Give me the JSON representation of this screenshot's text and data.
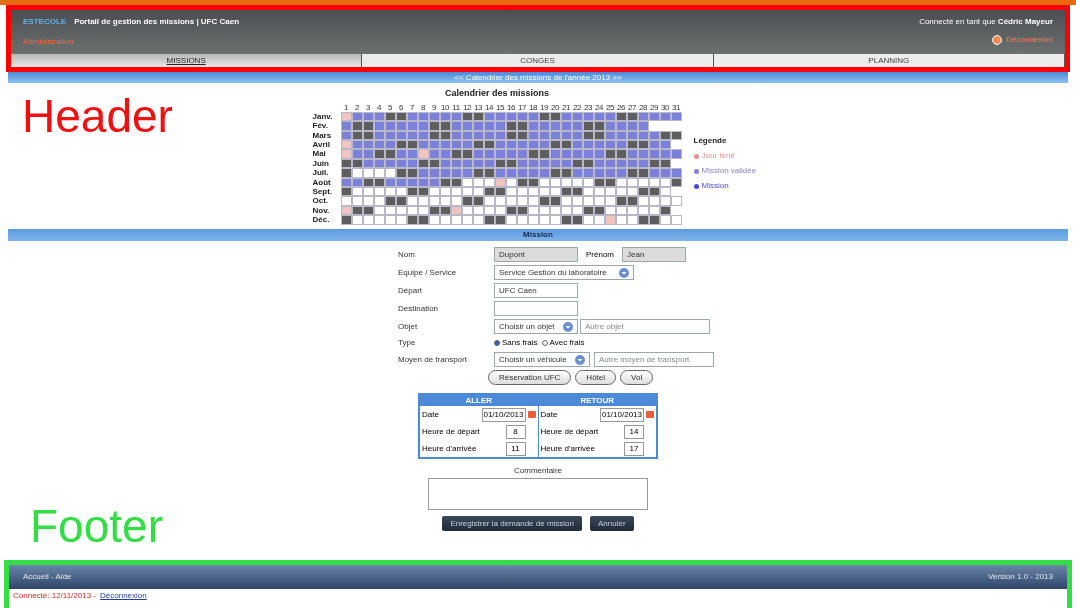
{
  "annotations": {
    "header_label": "Header",
    "footer_label": "Footer"
  },
  "header": {
    "brand": "ESTECOLE",
    "title": "Portail de gestion des missions | UFC Caen",
    "user_text": "Connecté en tant que **Cédric Mayeur**",
    "admin_link": "Administration",
    "logout": "Déconnexion"
  },
  "tabs": [
    {
      "label": "MISSIONS",
      "selected": true
    },
    {
      "label": "CONGES",
      "selected": false
    },
    {
      "label": "PLANNING",
      "selected": false
    }
  ],
  "subbar": "<< Calendrier des missions de l'année 2013 >>",
  "calendar": {
    "title": "Calendrier des missions",
    "days": [
      "1",
      "2",
      "3",
      "4",
      "5",
      "6",
      "7",
      "8",
      "9",
      "10",
      "11",
      "12",
      "13",
      "14",
      "15",
      "16",
      "17",
      "18",
      "19",
      "20",
      "21",
      "22",
      "23",
      "24",
      "25",
      "26",
      "27",
      "28",
      "29",
      "30",
      "31"
    ],
    "months": [
      {
        "label": "Janv.",
        "cells": [
          {
            "kind": "h"
          },
          {
            "kind": "m"
          },
          {
            "kind": "m"
          },
          {
            "kind": "m"
          },
          {
            "kind": "w"
          },
          {
            "kind": "w"
          },
          {
            "kind": "m"
          },
          {
            "kind": "m"
          },
          {
            "kind": "m"
          },
          {
            "kind": "m"
          },
          {
            "kind": "m"
          },
          {
            "kind": "w"
          },
          {
            "kind": "w"
          },
          {
            "kind": "m"
          },
          {
            "kind": "m"
          },
          {
            "kind": "m"
          },
          {
            "kind": "m"
          },
          {
            "kind": "m"
          },
          {
            "kind": "w"
          },
          {
            "kind": "w"
          },
          {
            "kind": "m"
          },
          {
            "kind": "m"
          },
          {
            "kind": "m"
          },
          {
            "kind": "m"
          },
          {
            "kind": "m"
          },
          {
            "kind": "w"
          },
          {
            "kind": "w"
          },
          {
            "kind": "m"
          },
          {
            "kind": "m"
          },
          {
            "kind": "m"
          },
          {
            "kind": "m"
          }
        ]
      },
      {
        "label": "Fév.",
        "cells": [
          {
            "kind": "m"
          },
          {
            "kind": "w"
          },
          {
            "kind": "w"
          },
          {
            "kind": "m"
          },
          {
            "kind": "m"
          },
          {
            "kind": "m"
          },
          {
            "kind": "m"
          },
          {
            "kind": "m"
          },
          {
            "kind": "w"
          },
          {
            "kind": "w"
          },
          {
            "kind": "m"
          },
          {
            "kind": "m"
          },
          {
            "kind": "m"
          },
          {
            "kind": "m"
          },
          {
            "kind": "m"
          },
          {
            "kind": "w"
          },
          {
            "kind": "w"
          },
          {
            "kind": "m"
          },
          {
            "kind": "m"
          },
          {
            "kind": "m"
          },
          {
            "kind": "m"
          },
          {
            "kind": "m"
          },
          {
            "kind": "w"
          },
          {
            "kind": "w"
          },
          {
            "kind": "m"
          },
          {
            "kind": "m"
          },
          {
            "kind": "m"
          },
          {
            "kind": "m"
          },
          {
            "kind": "x"
          },
          {
            "kind": "x"
          },
          {
            "kind": "x"
          }
        ]
      },
      {
        "label": "Mars",
        "cells": [
          {
            "kind": "m"
          },
          {
            "kind": "w"
          },
          {
            "kind": "w"
          },
          {
            "kind": "m"
          },
          {
            "kind": "m"
          },
          {
            "kind": "m"
          },
          {
            "kind": "m"
          },
          {
            "kind": "m"
          },
          {
            "kind": "w"
          },
          {
            "kind": "w"
          },
          {
            "kind": "m"
          },
          {
            "kind": "m"
          },
          {
            "kind": "m"
          },
          {
            "kind": "m"
          },
          {
            "kind": "m"
          },
          {
            "kind": "w"
          },
          {
            "kind": "w"
          },
          {
            "kind": "m"
          },
          {
            "kind": "m"
          },
          {
            "kind": "m"
          },
          {
            "kind": "m"
          },
          {
            "kind": "m"
          },
          {
            "kind": "w"
          },
          {
            "kind": "w"
          },
          {
            "kind": "m"
          },
          {
            "kind": "m"
          },
          {
            "kind": "m"
          },
          {
            "kind": "m"
          },
          {
            "kind": "m"
          },
          {
            "kind": "w"
          },
          {
            "kind": "w"
          }
        ]
      },
      {
        "label": "Avril",
        "cells": [
          {
            "kind": "h"
          },
          {
            "kind": "m"
          },
          {
            "kind": "m"
          },
          {
            "kind": "m"
          },
          {
            "kind": "m"
          },
          {
            "kind": "w"
          },
          {
            "kind": "w"
          },
          {
            "kind": "m"
          },
          {
            "kind": "m"
          },
          {
            "kind": "m"
          },
          {
            "kind": "m"
          },
          {
            "kind": "m"
          },
          {
            "kind": "w"
          },
          {
            "kind": "w"
          },
          {
            "kind": "m"
          },
          {
            "kind": "m"
          },
          {
            "kind": "m"
          },
          {
            "kind": "m"
          },
          {
            "kind": "m"
          },
          {
            "kind": "w"
          },
          {
            "kind": "w"
          },
          {
            "kind": "m"
          },
          {
            "kind": "m"
          },
          {
            "kind": "m"
          },
          {
            "kind": "m"
          },
          {
            "kind": "m"
          },
          {
            "kind": "w"
          },
          {
            "kind": "w"
          },
          {
            "kind": "m"
          },
          {
            "kind": "m"
          },
          {
            "kind": "x"
          }
        ]
      },
      {
        "label": "Mai",
        "cells": [
          {
            "kind": "h"
          },
          {
            "kind": "m"
          },
          {
            "kind": "m"
          },
          {
            "kind": "w"
          },
          {
            "kind": "w"
          },
          {
            "kind": "m"
          },
          {
            "kind": "m"
          },
          {
            "kind": "h"
          },
          {
            "kind": "m"
          },
          {
            "kind": "m"
          },
          {
            "kind": "w"
          },
          {
            "kind": "w"
          },
          {
            "kind": "m"
          },
          {
            "kind": "m"
          },
          {
            "kind": "m"
          },
          {
            "kind": "m"
          },
          {
            "kind": "m"
          },
          {
            "kind": "w"
          },
          {
            "kind": "w"
          },
          {
            "kind": "m"
          },
          {
            "kind": "m"
          },
          {
            "kind": "m"
          },
          {
            "kind": "m"
          },
          {
            "kind": "m"
          },
          {
            "kind": "w"
          },
          {
            "kind": "w"
          },
          {
            "kind": "m"
          },
          {
            "kind": "m"
          },
          {
            "kind": "m"
          },
          {
            "kind": "m"
          },
          {
            "kind": "m"
          }
        ]
      },
      {
        "label": "Juin",
        "cells": [
          {
            "kind": "w"
          },
          {
            "kind": "w"
          },
          {
            "kind": "m"
          },
          {
            "kind": "m"
          },
          {
            "kind": "m"
          },
          {
            "kind": "m"
          },
          {
            "kind": "m"
          },
          {
            "kind": "w"
          },
          {
            "kind": "w"
          },
          {
            "kind": "m"
          },
          {
            "kind": "m"
          },
          {
            "kind": "m"
          },
          {
            "kind": "m"
          },
          {
            "kind": "m"
          },
          {
            "kind": "w"
          },
          {
            "kind": "w"
          },
          {
            "kind": "m"
          },
          {
            "kind": "m"
          },
          {
            "kind": "m"
          },
          {
            "kind": "m"
          },
          {
            "kind": "m"
          },
          {
            "kind": "w"
          },
          {
            "kind": "w"
          },
          {
            "kind": "m"
          },
          {
            "kind": "m"
          },
          {
            "kind": "m"
          },
          {
            "kind": "m"
          },
          {
            "kind": "m"
          },
          {
            "kind": "w"
          },
          {
            "kind": "w"
          },
          {
            "kind": "x"
          }
        ]
      },
      {
        "label": "Juil.",
        "cells": [
          {
            "kind": "w"
          },
          {
            "kind": "f"
          },
          {
            "kind": "f"
          },
          {
            "kind": "f"
          },
          {
            "kind": "f"
          },
          {
            "kind": "w"
          },
          {
            "kind": "w"
          },
          {
            "kind": "m"
          },
          {
            "kind": "m"
          },
          {
            "kind": "m"
          },
          {
            "kind": "m"
          },
          {
            "kind": "m"
          },
          {
            "kind": "w"
          },
          {
            "kind": "w"
          },
          {
            "kind": "m"
          },
          {
            "kind": "m"
          },
          {
            "kind": "m"
          },
          {
            "kind": "m"
          },
          {
            "kind": "m"
          },
          {
            "kind": "w"
          },
          {
            "kind": "w"
          },
          {
            "kind": "m"
          },
          {
            "kind": "m"
          },
          {
            "kind": "m"
          },
          {
            "kind": "m"
          },
          {
            "kind": "m"
          },
          {
            "kind": "w"
          },
          {
            "kind": "w"
          },
          {
            "kind": "m"
          },
          {
            "kind": "m"
          },
          {
            "kind": "m"
          }
        ]
      },
      {
        "label": "Août",
        "cells": [
          {
            "kind": "m"
          },
          {
            "kind": "m"
          },
          {
            "kind": "w"
          },
          {
            "kind": "w"
          },
          {
            "kind": "m"
          },
          {
            "kind": "m"
          },
          {
            "kind": "m"
          },
          {
            "kind": "m"
          },
          {
            "kind": "m"
          },
          {
            "kind": "w"
          },
          {
            "kind": "w"
          },
          {
            "kind": "f"
          },
          {
            "kind": "f"
          },
          {
            "kind": "f"
          },
          {
            "kind": "h"
          },
          {
            "kind": "f"
          },
          {
            "kind": "w"
          },
          {
            "kind": "w"
          },
          {
            "kind": "f"
          },
          {
            "kind": "f"
          },
          {
            "kind": "f"
          },
          {
            "kind": "f"
          },
          {
            "kind": "f"
          },
          {
            "kind": "w"
          },
          {
            "kind": "w"
          },
          {
            "kind": "f"
          },
          {
            "kind": "f"
          },
          {
            "kind": "f"
          },
          {
            "kind": "f"
          },
          {
            "kind": "f"
          },
          {
            "kind": "w"
          }
        ]
      },
      {
        "label": "Sept.",
        "cells": [
          {
            "kind": "w"
          },
          {
            "kind": "f"
          },
          {
            "kind": "f"
          },
          {
            "kind": "f"
          },
          {
            "kind": "f"
          },
          {
            "kind": "f"
          },
          {
            "kind": "w"
          },
          {
            "kind": "w"
          },
          {
            "kind": "f"
          },
          {
            "kind": "f"
          },
          {
            "kind": "f"
          },
          {
            "kind": "f"
          },
          {
            "kind": "f"
          },
          {
            "kind": "w"
          },
          {
            "kind": "w"
          },
          {
            "kind": "f"
          },
          {
            "kind": "f"
          },
          {
            "kind": "f"
          },
          {
            "kind": "f"
          },
          {
            "kind": "f"
          },
          {
            "kind": "w"
          },
          {
            "kind": "w"
          },
          {
            "kind": "f"
          },
          {
            "kind": "f"
          },
          {
            "kind": "f"
          },
          {
            "kind": "f"
          },
          {
            "kind": "f"
          },
          {
            "kind": "w"
          },
          {
            "kind": "w"
          },
          {
            "kind": "f"
          },
          {
            "kind": "x"
          }
        ]
      },
      {
        "label": "Oct.",
        "cells": [
          {
            "kind": "f"
          },
          {
            "kind": "f"
          },
          {
            "kind": "f"
          },
          {
            "kind": "f"
          },
          {
            "kind": "w"
          },
          {
            "kind": "w"
          },
          {
            "kind": "f"
          },
          {
            "kind": "f"
          },
          {
            "kind": "f"
          },
          {
            "kind": "f"
          },
          {
            "kind": "f"
          },
          {
            "kind": "w"
          },
          {
            "kind": "w"
          },
          {
            "kind": "f"
          },
          {
            "kind": "f"
          },
          {
            "kind": "f"
          },
          {
            "kind": "f"
          },
          {
            "kind": "f"
          },
          {
            "kind": "w"
          },
          {
            "kind": "w"
          },
          {
            "kind": "f"
          },
          {
            "kind": "f"
          },
          {
            "kind": "f"
          },
          {
            "kind": "f"
          },
          {
            "kind": "f"
          },
          {
            "kind": "w"
          },
          {
            "kind": "w"
          },
          {
            "kind": "f"
          },
          {
            "kind": "f"
          },
          {
            "kind": "f"
          },
          {
            "kind": "f"
          }
        ]
      },
      {
        "label": "Nov.",
        "cells": [
          {
            "kind": "h"
          },
          {
            "kind": "w"
          },
          {
            "kind": "w"
          },
          {
            "kind": "f"
          },
          {
            "kind": "f"
          },
          {
            "kind": "f"
          },
          {
            "kind": "f"
          },
          {
            "kind": "f"
          },
          {
            "kind": "w"
          },
          {
            "kind": "w"
          },
          {
            "kind": "h"
          },
          {
            "kind": "f"
          },
          {
            "kind": "f"
          },
          {
            "kind": "f"
          },
          {
            "kind": "f"
          },
          {
            "kind": "w"
          },
          {
            "kind": "w"
          },
          {
            "kind": "f"
          },
          {
            "kind": "f"
          },
          {
            "kind": "f"
          },
          {
            "kind": "f"
          },
          {
            "kind": "f"
          },
          {
            "kind": "w"
          },
          {
            "kind": "w"
          },
          {
            "kind": "f"
          },
          {
            "kind": "f"
          },
          {
            "kind": "f"
          },
          {
            "kind": "f"
          },
          {
            "kind": "f"
          },
          {
            "kind": "w"
          },
          {
            "kind": "x"
          }
        ]
      },
      {
        "label": "Déc.",
        "cells": [
          {
            "kind": "w"
          },
          {
            "kind": "f"
          },
          {
            "kind": "f"
          },
          {
            "kind": "f"
          },
          {
            "kind": "f"
          },
          {
            "kind": "f"
          },
          {
            "kind": "w"
          },
          {
            "kind": "w"
          },
          {
            "kind": "f"
          },
          {
            "kind": "f"
          },
          {
            "kind": "f"
          },
          {
            "kind": "f"
          },
          {
            "kind": "f"
          },
          {
            "kind": "w"
          },
          {
            "kind": "w"
          },
          {
            "kind": "f"
          },
          {
            "kind": "f"
          },
          {
            "kind": "f"
          },
          {
            "kind": "f"
          },
          {
            "kind": "f"
          },
          {
            "kind": "w"
          },
          {
            "kind": "w"
          },
          {
            "kind": "f"
          },
          {
            "kind": "f"
          },
          {
            "kind": "h"
          },
          {
            "kind": "f"
          },
          {
            "kind": "f"
          },
          {
            "kind": "w"
          },
          {
            "kind": "w"
          },
          {
            "kind": "f"
          },
          {
            "kind": "f"
          }
        ]
      }
    ],
    "legend": {
      "title": "Légende",
      "items": [
        {
          "label": "Jour férié",
          "color": "#e89090"
        },
        {
          "label": "Mission validée",
          "color": "#8a7fd0"
        },
        {
          "label": "Mission",
          "color": "#4a4ad8"
        }
      ]
    }
  },
  "section_bar": "Mission",
  "form": {
    "nom_label": "Nom",
    "nom_value": "Dupont",
    "prenom_label": "Prénom",
    "prenom_value": "Jean",
    "service_label": "Equipe / Service",
    "service_value": "Service Gestion du laboratoire",
    "depart_label": "Départ",
    "depart_value": "UFC Caen",
    "destination_label": "Destination",
    "objet_label": "Objet",
    "objet_value": "Choisir un objet",
    "objet_other_placeholder": "Autre objet",
    "type_label": "Type",
    "types": [
      {
        "label": "Sans frais",
        "selected": true
      },
      {
        "label": "Avec frais",
        "selected": false
      }
    ],
    "transport_label": "Moyen de transport",
    "transport_value": "Choisir un véhicule",
    "transport_other_placeholder": "Autre moyen de transport",
    "buttons": [
      "Réservation UFC",
      "Hôtel",
      "Vol"
    ]
  },
  "schedule": {
    "columns": [
      {
        "title": "ALLER",
        "date_label": "Date",
        "date_value": "01/10/2013",
        "dep_label": "Heure de départ",
        "dep_value": "8",
        "arr_label": "Heure d'arrivée",
        "arr_value": "11"
      },
      {
        "title": "RETOUR",
        "date_label": "Date",
        "date_value": "01/10/2013",
        "dep_label": "Heure de départ",
        "dep_value": "14",
        "arr_label": "Heure d'arrivée",
        "arr_value": "17"
      }
    ]
  },
  "comment_label": "Commentaire",
  "actions": [
    "Enregistrer la demande de mission",
    "Annuler"
  ],
  "footer": {
    "left": "Accueil - Aide",
    "right": "Version 1.0 - 2013",
    "status": "Connecté: 12/11/2013 -",
    "status_link": "Déconnexion"
  }
}
